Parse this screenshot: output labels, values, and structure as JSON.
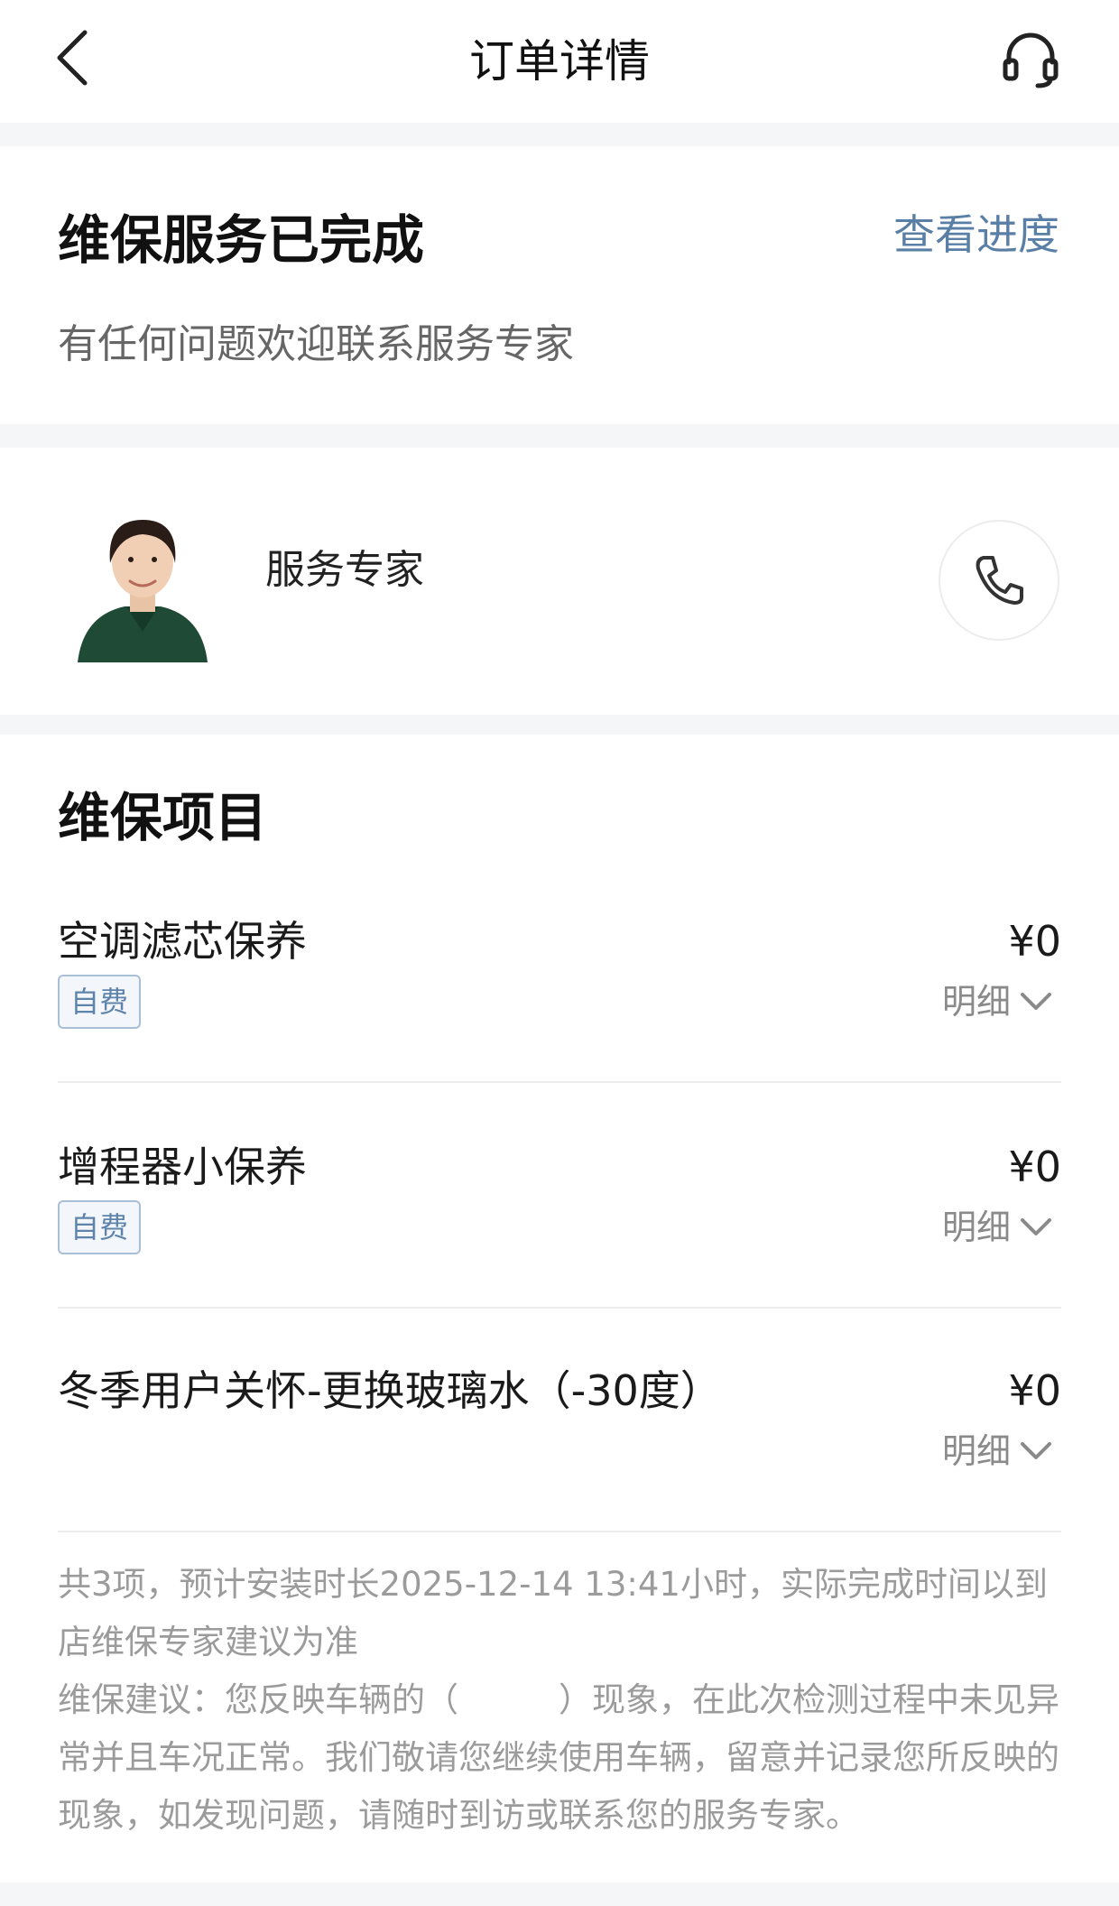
{
  "header": {
    "title": "订单详情",
    "back_icon": "chevron-left-icon",
    "service_icon": "headset-icon"
  },
  "status": {
    "title": "维保服务已完成",
    "progress_link": "查看进度",
    "subtitle": "有任何问题欢迎联系服务专家"
  },
  "expert": {
    "label": "服务专家",
    "phone_icon": "phone-icon"
  },
  "maintenance": {
    "section_title": "维保项目",
    "items": [
      {
        "name": "空调滤芯保养",
        "price": "¥0",
        "tag": "自费",
        "detail": "明细"
      },
      {
        "name": "增程器小保养",
        "price": "¥0",
        "tag": "自费",
        "detail": "明细"
      },
      {
        "name": "冬季用户关怀-更换玻璃水（-30度）",
        "price": "¥0",
        "detail": "明细"
      }
    ],
    "summary": "共3项，预计安装时长2025-12-14 13:41小时，实际完成时间以到店维保专家建议为准",
    "advice": "维保建议：您反映车辆的（　　　）现象，在此次检测过程中未见异常并且车况正常。我们敬请您继续使用车辆，留意并记录您所反映的现象，如发现问题，请随时到访或联系您的服务专家。"
  },
  "colors": {
    "accent": "#5a7fa6",
    "tag_border": "#a9bfd6",
    "tag_text": "#5f84ab",
    "muted": "#9b9b9b",
    "background": "#f5f6f7"
  }
}
